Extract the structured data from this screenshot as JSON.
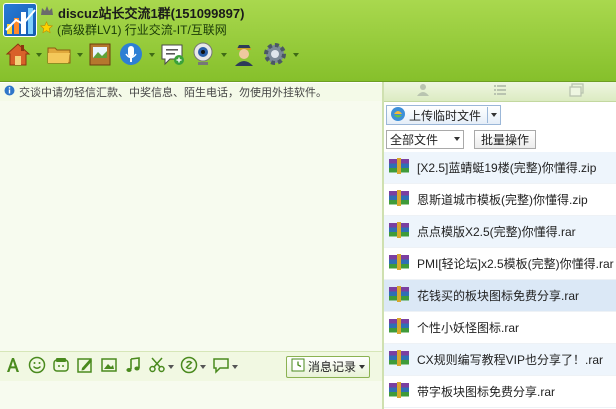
{
  "header": {
    "title": "discuz站长交流1群(151099897)",
    "subtitle": "(高级群LV1) 行业交流-IT/互联网"
  },
  "toolbar": {
    "items": [
      {
        "icon": "home-icon"
      },
      {
        "icon": "folder-icon"
      },
      {
        "icon": "album-icon"
      },
      {
        "icon": "microphone-icon"
      },
      {
        "icon": "message-add-icon"
      },
      {
        "icon": "webcam-icon"
      },
      {
        "icon": "admin-icon"
      },
      {
        "icon": "gear-icon"
      }
    ]
  },
  "notice": {
    "text": "交谈中请勿轻信汇款、中奖信息、陌生电话，勿使用外挂软件。"
  },
  "input_bar": {
    "history_label": "消息记录"
  },
  "side": {
    "upload_label": "上传临时文件",
    "filter_selected": "全部文件",
    "bulk_label": "批量操作",
    "files": [
      {
        "name": "[X2.5]蓝蜻蜓19楼(完整)你懂得.zip",
        "icon": "rar-archive-icon"
      },
      {
        "name": "恩斯道城市模板(完整)你懂得.zip",
        "icon": "rar-archive-icon"
      },
      {
        "name": "点点模版X2.5(完整)你懂得.rar",
        "icon": "rar-archive-icon"
      },
      {
        "name": "PMI[轻论坛]x2.5模板(完整)你懂得.rar",
        "icon": "rar-archive-icon"
      },
      {
        "name": "花钱买的板块图标免费分享.rar",
        "icon": "rar-archive-icon"
      },
      {
        "name": "个性小妖怪图标.rar",
        "icon": "rar-archive-icon"
      },
      {
        "name": "CX规则编写教程VIP也分享了！.rar",
        "icon": "rar-archive-icon"
      },
      {
        "name": "带字板块图标免费分享.rar",
        "icon": "rar-archive-icon"
      }
    ]
  },
  "colors": {
    "header_green": "#8cc63f",
    "selected_row": "#dbe8f6"
  }
}
